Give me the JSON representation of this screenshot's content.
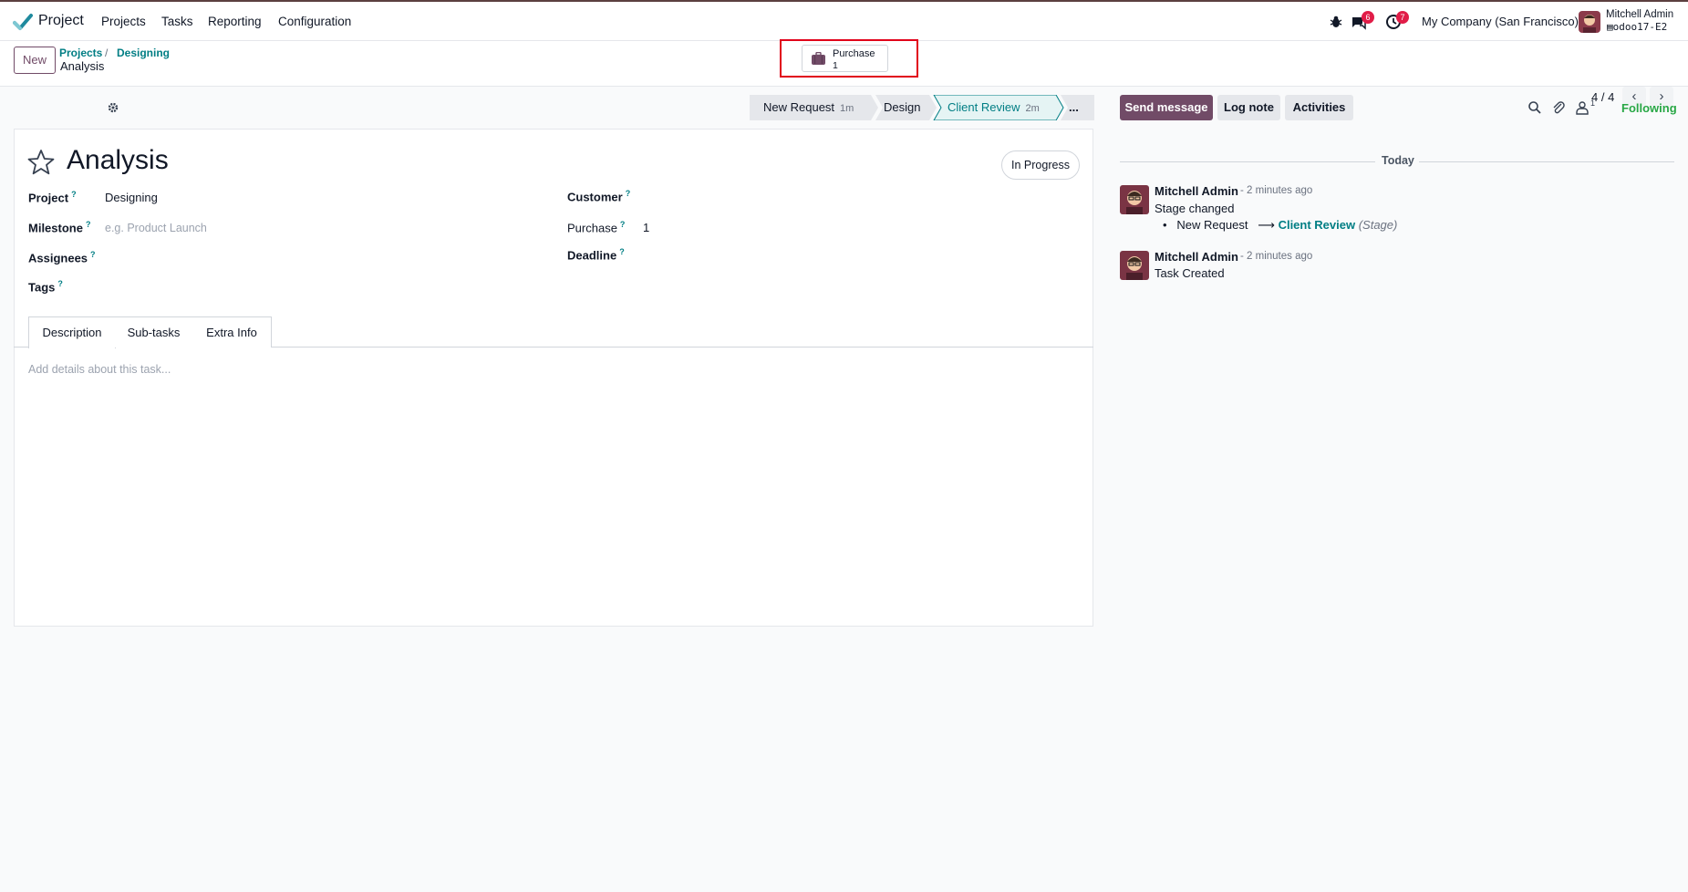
{
  "navbar": {
    "app_name": "Project",
    "menu": [
      "Projects",
      "Tasks",
      "Reporting",
      "Configuration"
    ],
    "messages_count": "6",
    "activities_count": "7",
    "company": "My Company (San Francisco)",
    "user_name": "Mitchell Admin",
    "database": "odoo17-E2"
  },
  "control_panel": {
    "new_label": "New",
    "breadcrumbs": [
      "Projects",
      "Designing"
    ],
    "record_name": "Analysis",
    "smart_button": {
      "label": "Purchase",
      "value": "1"
    },
    "pager": "4 / 4"
  },
  "statusbar": {
    "stages": [
      {
        "name": "New Request",
        "duration": "1m"
      },
      {
        "name": "Design",
        "duration": ""
      },
      {
        "name": "Client Review",
        "duration": "2m"
      }
    ],
    "more": "..."
  },
  "form": {
    "title": "Analysis",
    "state": "In Progress",
    "help_mark": "?",
    "fields": {
      "project": {
        "label": "Project",
        "value": "Designing"
      },
      "milestone": {
        "label": "Milestone",
        "placeholder": "e.g. Product Launch"
      },
      "assignees": {
        "label": "Assignees"
      },
      "tags": {
        "label": "Tags"
      },
      "customer": {
        "label": "Customer"
      },
      "purchase": {
        "label": "Purchase",
        "value": "1"
      },
      "deadline": {
        "label": "Deadline"
      }
    },
    "tabs": [
      "Description",
      "Sub-tasks",
      "Extra Info"
    ],
    "description_placeholder": "Add details about this task..."
  },
  "chatter": {
    "send_message": "Send message",
    "log_note": "Log note",
    "activities": "Activities",
    "followers_count": "1",
    "following": "Following",
    "date_separator": "Today",
    "messages": [
      {
        "author": "Mitchell Admin",
        "time": "- 2 minutes ago",
        "text": "Stage changed",
        "change": {
          "from": "New Request",
          "arrow": "⟶",
          "to": "Client Review",
          "field": "(Stage)"
        }
      },
      {
        "author": "Mitchell Admin",
        "time": "- 2 minutes ago",
        "text": "Task Created"
      }
    ]
  },
  "colors": {
    "primary": "#714b67",
    "link": "#017e84",
    "following": "#28a745",
    "badge": "#e11d48",
    "highlight": "#e1001a"
  }
}
